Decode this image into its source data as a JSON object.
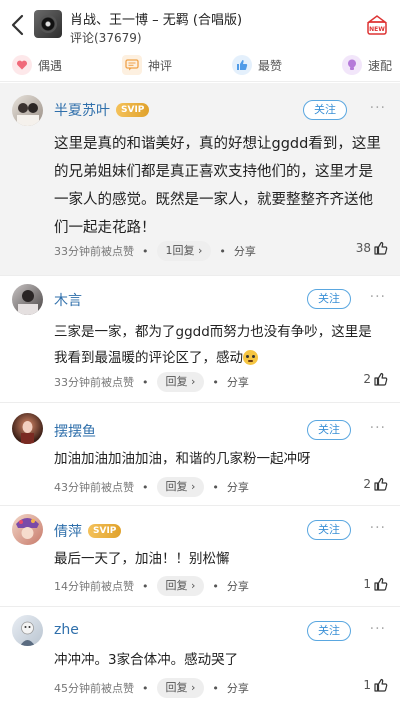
{
  "header": {
    "song_title": "肖战、王一博 – 无羁 (合唱版)",
    "comment_count": "评论(37679)",
    "new_badge": "NEW"
  },
  "tabs": [
    {
      "label": "偶遇",
      "icon": "heart-icon",
      "color": "#f06a7a"
    },
    {
      "label": "神评",
      "icon": "chat-icon",
      "color": "#f0a24a"
    },
    {
      "label": "最赞",
      "icon": "thumb-icon",
      "color": "#4f9be8"
    },
    {
      "label": "速配",
      "icon": "lightbulb-icon",
      "color": "#b57ad9"
    }
  ],
  "comments": [
    {
      "user": "半夏苏叶",
      "svip": "SVIP",
      "follow": "关注",
      "more": "···",
      "text": "这里是真的和谐美好，真的好想让ggdd看到，这里的兄弟姐妹们都是真正喜欢支持他们的，这里才是一家人的感觉。既然是一家人，就要整整齐齐送他们一起走花路！",
      "time": "33分钟前被点赞",
      "reply": "1回复 ›",
      "share": "分享",
      "likes": "38"
    },
    {
      "user": "木言",
      "follow": "关注",
      "more": "···",
      "text": "三家是一家，都为了ggdd而努力也没有争吵，这里是我看到最温暖的评论区了，感动",
      "time": "33分钟前被点赞",
      "reply": "回复 ›",
      "share": "分享",
      "likes": "2"
    },
    {
      "user": "摆摆鱼",
      "follow": "关注",
      "more": "···",
      "text": "加油加油加油加油，和谐的几家粉一起冲呀",
      "time": "43分钟前被点赞",
      "reply": "回复 ›",
      "share": "分享",
      "likes": "2"
    },
    {
      "user": "倩萍",
      "svip": "SVIP",
      "follow": "关注",
      "more": "···",
      "text": "最后一天了，加油！！别松懈",
      "time": "14分钟前被点赞",
      "reply": "回复 ›",
      "share": "分享",
      "likes": "1"
    },
    {
      "user": "zhe",
      "follow": "关注",
      "more": "···",
      "text": "冲冲冲。3家合体冲。感动哭了",
      "time": "45分钟前被点赞",
      "reply": "回复 ›",
      "share": "分享",
      "likes": "1"
    }
  ],
  "colors": {
    "link": "#2f6fab",
    "accent": "#3a90d6",
    "svip": "#e8ac33"
  }
}
